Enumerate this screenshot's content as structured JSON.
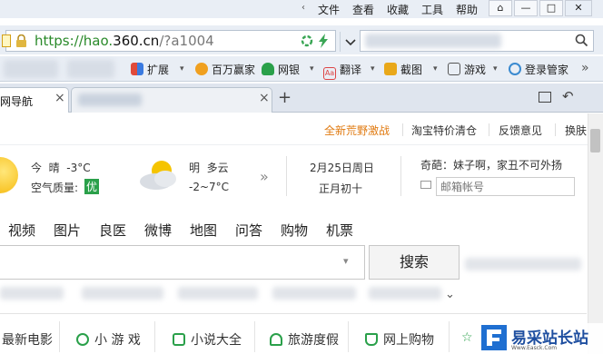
{
  "menu": [
    "文件",
    "查看",
    "收藏",
    "工具",
    "帮助"
  ],
  "window_buttons": [
    "⌂",
    "—",
    "□",
    "✕"
  ],
  "address": {
    "prefix": "https://hao.",
    "domain": "360.cn",
    "suffix": "/?a1004"
  },
  "toolbar": [
    "扩展",
    "百万赢家",
    "网银",
    "翻译",
    "截图",
    "游戏",
    "登录管家"
  ],
  "tabs": {
    "active": "网导航",
    "close": "×",
    "new": "+"
  },
  "toplinks": [
    "全新荒野激战",
    "淘宝特价清仓",
    "反馈意见",
    "换肤"
  ],
  "weather": {
    "today": "今  晴  -3°C",
    "aq_label": "空气质量:",
    "aq_value": "优",
    "tomorrow": "明  多云",
    "tomorrow_temp": "-2~7°C",
    "arrow": "»"
  },
  "date": {
    "solar": "2月25日周日",
    "lunar": "正月初十"
  },
  "topic": {
    "text": "奇葩：妹子啊，家丑不可外扬",
    "mail_placeholder": "邮箱帐号"
  },
  "nav_tabs": [
    "视频",
    "图片",
    "良医",
    "微博",
    "地图",
    "问答",
    "购物",
    "机票"
  ],
  "search": {
    "button": "搜索",
    "dropdown": "▾",
    "expand": "⌄"
  },
  "quicklinks": [
    "最新电影",
    "小 游 戏",
    "小说大全",
    "旅游度假",
    "网上购物"
  ],
  "watermark": {
    "text": "易采站长站",
    "sub": "Www.Easck.Com"
  },
  "colors": {
    "accent": "#e07a10",
    "green": "#2aa04a",
    "chrome": "#e9eef5"
  }
}
